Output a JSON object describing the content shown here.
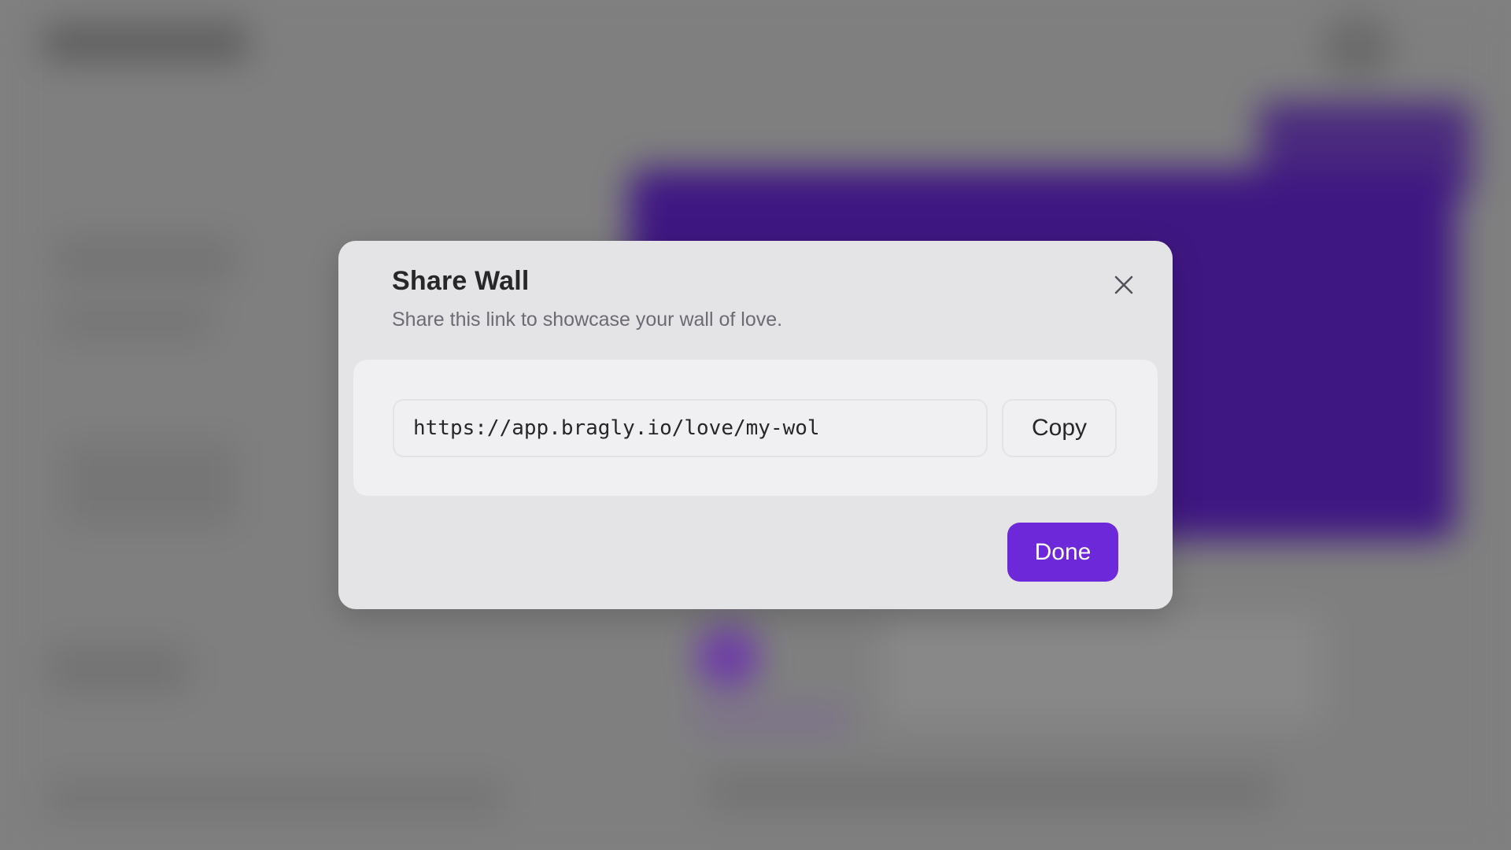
{
  "modal": {
    "title": "Share Wall",
    "subtitle": "Share this link to showcase your wall of love.",
    "close_icon": "close-icon",
    "link": {
      "value": "https://app.bragly.io/love/my-wol",
      "copy_label": "Copy"
    },
    "done_label": "Done"
  },
  "colors": {
    "accent": "#6d28d9",
    "overlay": "#808080",
    "modal_bg": "#e4e4e7",
    "panel_bg": "#f0f0f2"
  }
}
